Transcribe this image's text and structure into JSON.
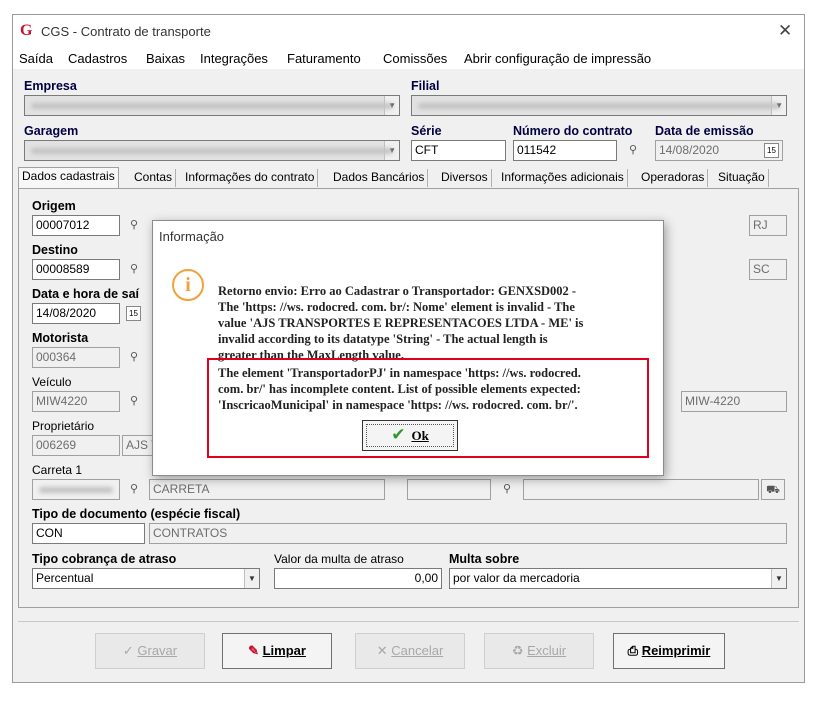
{
  "window": {
    "title": "CGS - Contrato de transporte",
    "logo": "G"
  },
  "menu": [
    "Saída",
    "Cadastros",
    "Baixas",
    "Integrações",
    "Faturamento",
    "Comissões",
    "Abrir configuração de impressão"
  ],
  "header": {
    "empresa_label": "Empresa",
    "filial_label": "Filial",
    "garagem_label": "Garagem",
    "serie_label": "Série",
    "serie_value": "CFT",
    "numero_label": "Número do contrato",
    "numero_value": "011542",
    "data_emissao_label": "Data de emissão",
    "data_emissao_value": "14/08/2020"
  },
  "tabs": [
    "Dados cadastrais",
    "Contas",
    "Informações do contrato",
    "Dados Bancários",
    "Diversos",
    "Informações adicionais",
    "Operadoras",
    "Situação"
  ],
  "form": {
    "origem_label": "Origem",
    "origem_value": "00007012",
    "origem_uf": "RJ",
    "destino_label": "Destino",
    "destino_value": "00008589",
    "destino_uf": "SC",
    "data_saida_label": "Data e hora de saí",
    "data_saida_value": "14/08/2020",
    "motorista_label": "Motorista",
    "motorista_value": "000364",
    "veiculo_label": "Veículo",
    "veiculo_value": "MIW4220",
    "veiculo_placa": "MIW-4220",
    "proprietario_label": "Proprietário",
    "proprietario_value": "006269",
    "proprietario_name": "AJS T",
    "carreta_label": "Carreta 1",
    "carreta_desc": "CARRETA",
    "tipo_doc_label": "Tipo de documento (espécie fiscal)",
    "tipo_doc_value": "CON",
    "tipo_doc_desc": "CONTRATOS",
    "tipo_cobranca_label": "Tipo cobrança de atraso",
    "tipo_cobranca_value": "Percentual",
    "valor_multa_label": "Valor da multa de atraso",
    "valor_multa_value": "0,00",
    "multa_sobre_label": "Multa sobre",
    "multa_sobre_value": "por valor da mercadoria"
  },
  "buttons": {
    "gravar": "Gravar",
    "limpar": "Limpar",
    "cancelar": "Cancelar",
    "excluir": "Excluir",
    "reimprimir": "Reimprimir"
  },
  "dialog": {
    "title": "Informação",
    "lines": [
      "Retorno envio: Erro ao Cadastrar o Transportador: GENXSD002 -",
      "The 'https: //ws. rodocred. com. br/: Nome' element is invalid - The",
      "value 'AJS TRANSPORTES E REPRESENTACOES LTDA - ME' is",
      "invalid according to its datatype 'String' - The actual length is",
      "greater than the MaxLength value.",
      "The element 'TransportadorPJ' in namespace 'https: //ws. rodocred.",
      "com. br/' has incomplete content. List of possible elements expected:",
      "'InscricaoMunicipal' in namespace 'https: //ws. rodocred. com. br/'."
    ],
    "ok_label": "Ok"
  },
  "colors": {
    "highlight_box": "#e0001b",
    "info_icon": "#f0a13a",
    "ok_check": "#2e9a2e",
    "logo": "#c8102e"
  }
}
